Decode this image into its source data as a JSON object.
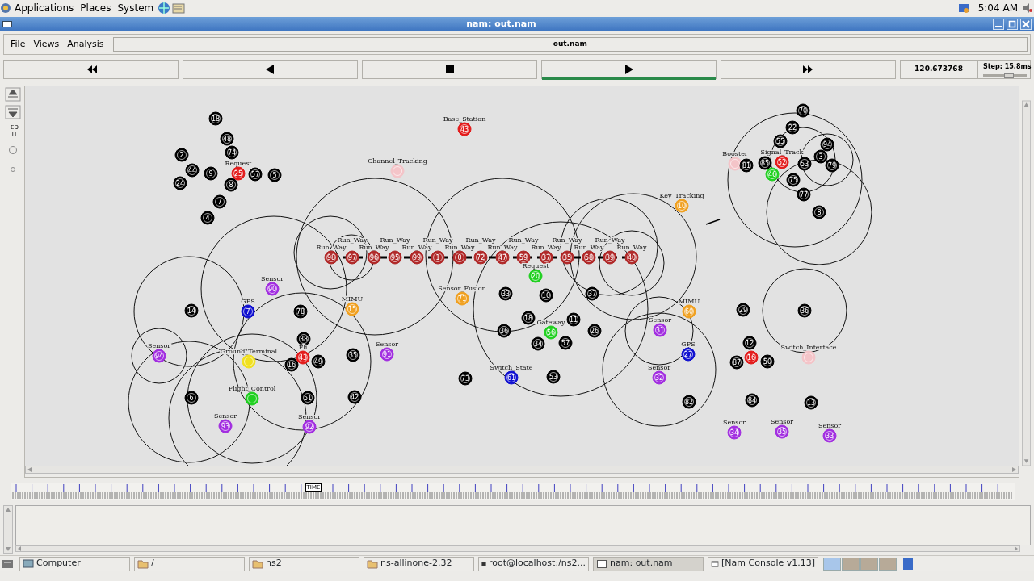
{
  "top_panel": {
    "menus": [
      "Applications",
      "Places",
      "System"
    ],
    "clock": "5:04 AM"
  },
  "window": {
    "title": "nam: out.nam"
  },
  "menu": [
    "File",
    "Views",
    "Analysis"
  ],
  "file_field": "out.nam",
  "controls": [
    {
      "kind": "rewind",
      "selected": false
    },
    {
      "kind": "back",
      "selected": false
    },
    {
      "kind": "stop",
      "selected": false
    },
    {
      "kind": "play",
      "selected": true
    },
    {
      "kind": "forward",
      "selected": false
    }
  ],
  "time": "120.673768",
  "step": {
    "label": "Step: 15.8ms",
    "level": 0.6
  },
  "edit_tool": "ED IT",
  "nodes": [
    {
      "label": "18",
      "color": "#000000"
    },
    {
      "label": "48",
      "color": "#000000"
    },
    {
      "label": "2",
      "color": "#000000"
    },
    {
      "label": "74",
      "color": "#000000"
    },
    {
      "label": "44",
      "color": "#000000"
    },
    {
      "label": "9",
      "color": "#000000"
    },
    {
      "label": "25",
      "color": "#e31b1b",
      "caption": "Request"
    },
    {
      "label": "57",
      "color": "#000000"
    },
    {
      "label": "5",
      "color": "#000000"
    },
    {
      "label": "24",
      "color": "#000000"
    },
    {
      "label": "8",
      "color": "#000000"
    },
    {
      "label": "7",
      "color": "#000000"
    },
    {
      "label": "4",
      "color": "#000000"
    },
    {
      "label": "14",
      "color": "#000000"
    },
    {
      "label": "7",
      "color": "#1010d0",
      "caption": "GPS"
    },
    {
      "label": "90",
      "color": "#a22ee0",
      "caption": "Sensor"
    },
    {
      "label": "78",
      "color": "#000000"
    },
    {
      "label": "15",
      "color": "#f0a020",
      "caption": "MIMU"
    },
    {
      "label": "38",
      "color": "#000000"
    },
    {
      "label": "94",
      "color": "#a22ee0",
      "caption": "Sensor"
    },
    {
      "color": "#f0e020",
      "caption": "Ground_Terminal"
    },
    {
      "label": "16",
      "color": "#000000"
    },
    {
      "label": "43",
      "color": "#e31b1b",
      "caption": "Fli"
    },
    {
      "label": "49",
      "color": "#000000"
    },
    {
      "label": "35",
      "color": "#000000"
    },
    {
      "label": "6",
      "color": "#000000"
    },
    {
      "color": "#20d020",
      "caption": "Flight_Control"
    },
    {
      "label": "51",
      "color": "#000000"
    },
    {
      "label": "42",
      "color": "#000000"
    },
    {
      "label": "93",
      "color": "#a22ee0",
      "caption": "Sensor"
    },
    {
      "label": "92",
      "color": "#a22ee0",
      "caption": "Sensor"
    },
    {
      "label": "91",
      "color": "#a22ee0",
      "caption": "Sensor"
    },
    {
      "label": "43",
      "color": "#e31b1b",
      "caption": "Base_Station"
    },
    {
      "color": "#f4c4c8",
      "caption": "Channel_Tracking"
    },
    {
      "label": "98",
      "color": "#b02828",
      "caption": "Run_Way"
    },
    {
      "label": "97",
      "color": "#b02828",
      "caption": "Run_Way"
    },
    {
      "label": "96",
      "color": "#b02828",
      "caption": "Run_Way"
    },
    {
      "label": "95",
      "color": "#b02828",
      "caption": "Run_Way"
    },
    {
      "label": "99",
      "color": "#b02828",
      "caption": "Run_Way"
    },
    {
      "label": "1",
      "color": "#b02828",
      "caption": "Run_Way"
    },
    {
      "label": "0",
      "color": "#b02828",
      "caption": "Run_Way"
    },
    {
      "label": "72",
      "color": "#b02828",
      "caption": "Run_Way"
    },
    {
      "label": "47",
      "color": "#b02828",
      "caption": "Run_Way"
    },
    {
      "label": "59",
      "color": "#b02828",
      "caption": "Run_Way"
    },
    {
      "label": "37",
      "color": "#b02828",
      "caption": "Run_Way"
    },
    {
      "label": "35",
      "color": "#b02828",
      "caption": "Run_Way"
    },
    {
      "label": "58",
      "color": "#b02828",
      "caption": "Run_Way"
    },
    {
      "label": "39",
      "color": "#b02828",
      "caption": "Run_Way"
    },
    {
      "label": "40",
      "color": "#b02828",
      "caption": "Run_Way"
    },
    {
      "label": "20",
      "color": "#20d020",
      "caption": "Request"
    },
    {
      "label": "71",
      "color": "#f0a020",
      "caption": "Sensor_Fusion"
    },
    {
      "label": "33",
      "color": "#000000"
    },
    {
      "label": "10",
      "color": "#000000"
    },
    {
      "label": "37",
      "color": "#000000"
    },
    {
      "label": "18",
      "color": "#000000"
    },
    {
      "label": "11",
      "color": "#000000"
    },
    {
      "label": "36",
      "color": "#000000"
    },
    {
      "label": "56",
      "color": "#20d020",
      "caption": "Gateway"
    },
    {
      "label": "26",
      "color": "#000000"
    },
    {
      "label": "34",
      "color": "#000000"
    },
    {
      "label": "57",
      "color": "#000000"
    },
    {
      "label": "73",
      "color": "#000000"
    },
    {
      "label": "61",
      "color": "#1010d0",
      "caption": "Switch_State"
    },
    {
      "label": "53",
      "color": "#000000"
    },
    {
      "label": "10",
      "color": "#f0a020",
      "caption": "Key_Tracking"
    },
    {
      "label": "31",
      "color": "#a22ee0",
      "caption": "Sensor"
    },
    {
      "label": "60",
      "color": "#f0a020",
      "caption": "MIMU"
    },
    {
      "label": "27",
      "color": "#1010d0",
      "caption": "GPS"
    },
    {
      "label": "32",
      "color": "#a22ee0",
      "caption": "Sensor"
    },
    {
      "label": "82",
      "color": "#000000"
    },
    {
      "label": "70",
      "color": "#000000"
    },
    {
      "label": "22",
      "color": "#000000"
    },
    {
      "label": "55",
      "color": "#000000"
    },
    {
      "label": "94",
      "color": "#000000"
    },
    {
      "color": "#f4c4c8",
      "caption": "Booster"
    },
    {
      "label": "81",
      "color": "#000000"
    },
    {
      "label": "85",
      "color": "#000000"
    },
    {
      "label": "52",
      "color": "#e31b1b",
      "caption": "Signal_Track"
    },
    {
      "label": "53",
      "color": "#000000"
    },
    {
      "label": "3",
      "color": "#000000"
    },
    {
      "label": "79",
      "color": "#000000"
    },
    {
      "label": "46",
      "color": "#20d020"
    },
    {
      "label": "75",
      "color": "#000000"
    },
    {
      "label": "77",
      "color": "#000000"
    },
    {
      "label": "8",
      "color": "#000000"
    },
    {
      "label": "29",
      "color": "#000000"
    },
    {
      "label": "36",
      "color": "#000000"
    },
    {
      "label": "12",
      "color": "#000000"
    },
    {
      "label": "16",
      "color": "#e31b1b"
    },
    {
      "label": "87",
      "color": "#000000"
    },
    {
      "label": "50",
      "color": "#000000"
    },
    {
      "color": "#f4c4c8",
      "caption": "Switch_Interface"
    },
    {
      "label": "84",
      "color": "#000000"
    },
    {
      "label": "13",
      "color": "#000000"
    },
    {
      "label": "34",
      "color": "#a22ee0",
      "caption": "Sensor"
    },
    {
      "label": "35",
      "color": "#a22ee0",
      "caption": "Sensor"
    },
    {
      "label": "33",
      "color": "#a22ee0",
      "caption": "Sensor"
    }
  ],
  "timeline": {
    "marker": "TIME",
    "level": 0.3
  },
  "taskbar": [
    {
      "label": "Computer",
      "kind": "computer",
      "selected": false
    },
    {
      "label": "/",
      "kind": "folder",
      "selected": false
    },
    {
      "label": "ns2",
      "kind": "folder",
      "selected": false
    },
    {
      "label": "ns-allinone-2.32",
      "kind": "folder",
      "selected": false
    },
    {
      "label": "root@localhost:/ns2...",
      "kind": "terminal",
      "selected": false
    },
    {
      "label": "nam: out.nam",
      "kind": "window",
      "selected": true
    },
    {
      "label": "[Nam Console v1.13]",
      "kind": "window",
      "selected": false
    }
  ],
  "workspaces": [
    {
      "selected": true
    },
    {
      "selected": false
    },
    {
      "selected": false
    },
    {
      "selected": false
    }
  ]
}
